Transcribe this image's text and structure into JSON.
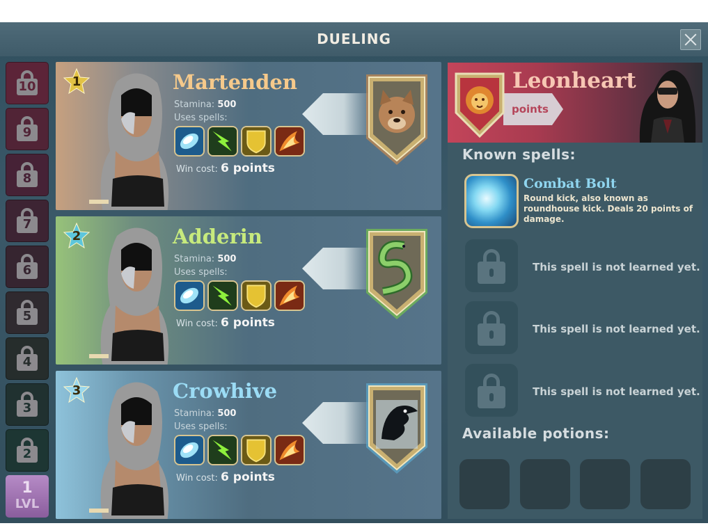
{
  "window": {
    "title": "DUELING",
    "close_icon": "close-icon"
  },
  "levels": {
    "locked": [
      {
        "num": "10",
        "color": "#5c2438"
      },
      {
        "num": "9",
        "color": "#512436"
      },
      {
        "num": "8",
        "color": "#462236"
      },
      {
        "num": "7",
        "color": "#3d2433"
      },
      {
        "num": "6",
        "color": "#362530"
      },
      {
        "num": "5",
        "color": "#2f2a2f"
      },
      {
        "num": "4",
        "color": "#262d2c"
      },
      {
        "num": "3",
        "color": "#203130"
      },
      {
        "num": "2",
        "color": "#1d3633"
      }
    ],
    "current": {
      "num": "1",
      "label": "LVL"
    }
  },
  "duels": [
    {
      "rank": "1",
      "name": "Martenden",
      "name_color": "#f5c98b",
      "stamina_label": "Stamina:",
      "stamina_value": "500",
      "spells_label": "Uses spells:",
      "spells": [
        "ice-shard-icon",
        "lightning-icon",
        "shield-icon",
        "fire-icon"
      ],
      "win_label": "Win cost:",
      "win_value": "6 points",
      "crest": "marten-crest-icon",
      "accent": "#e88f3e"
    },
    {
      "rank": "2",
      "name": "Adderin",
      "name_color": "#c7ea7d",
      "stamina_label": "Stamina:",
      "stamina_value": "500",
      "spells_label": "Uses spells:",
      "spells": [
        "ice-shard-icon",
        "lightning-icon",
        "shield-icon",
        "fire-icon"
      ],
      "win_label": "Win cost:",
      "win_value": "6 points",
      "crest": "serpent-crest-icon",
      "accent": "#7fd83c"
    },
    {
      "rank": "3",
      "name": "Crowhive",
      "name_color": "#9bdcf5",
      "stamina_label": "Stamina:",
      "stamina_value": "500",
      "spells_label": "Uses spells:",
      "spells": [
        "ice-shard-icon",
        "lightning-icon",
        "shield-icon",
        "fire-icon"
      ],
      "win_label": "Win cost:",
      "win_value": "6 points",
      "crest": "crow-crest-icon",
      "accent": "#5fb8e0"
    }
  ],
  "player": {
    "name": "Leonheart",
    "points_label": "points",
    "crest": "lion-crest-icon",
    "known_spells_title": "Known spells:",
    "known_spell": {
      "name": "Combat Bolt",
      "desc": "Round kick, also known as roundhouse kick. Deals 20 points of damage."
    },
    "locked_spell_text": [
      "This spell is not learned yet.",
      "This spell is not learned yet.",
      "This spell is not learned yet."
    ],
    "potions_title": "Available potions:",
    "potion_slots": 4
  }
}
